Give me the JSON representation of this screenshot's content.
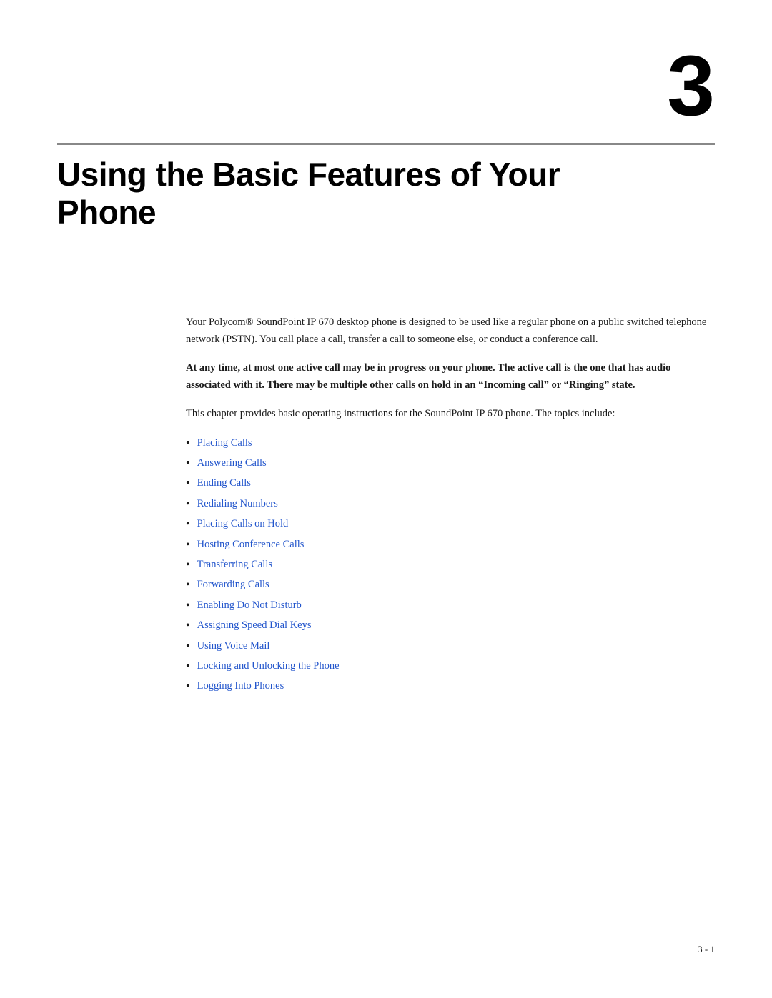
{
  "chapter": {
    "number": "3",
    "title_line1": "Using the Basic Features of Your",
    "title_line2": "Phone"
  },
  "paragraphs": {
    "p1": "Your Polycom® SoundPoint IP 670 desktop phone is designed to be used like a regular phone on a public switched telephone network (PSTN). You call place a call, transfer a call to someone else, or conduct a conference call.",
    "p2": "At any time, at most one active call may be in progress on your phone. The active call is the one that has audio associated with it. There may be multiple other calls on hold in an “Incoming call” or “Ringing” state.",
    "p3": "This chapter provides basic operating instructions for the SoundPoint IP 670 phone. The topics include:"
  },
  "topics": [
    {
      "label": "Placing Calls",
      "href": "#placing-calls"
    },
    {
      "label": "Answering Calls",
      "href": "#answering-calls"
    },
    {
      "label": "Ending Calls",
      "href": "#ending-calls"
    },
    {
      "label": "Redialing Numbers",
      "href": "#redialing-numbers"
    },
    {
      "label": "Placing Calls on Hold",
      "href": "#placing-calls-on-hold"
    },
    {
      "label": "Hosting Conference Calls",
      "href": "#hosting-conference-calls"
    },
    {
      "label": "Transferring Calls",
      "href": "#transferring-calls"
    },
    {
      "label": "Forwarding Calls",
      "href": "#forwarding-calls"
    },
    {
      "label": "Enabling Do Not Disturb",
      "href": "#enabling-do-not-disturb"
    },
    {
      "label": "Assigning Speed Dial Keys",
      "href": "#assigning-speed-dial-keys"
    },
    {
      "label": "Using Voice Mail",
      "href": "#using-voice-mail"
    },
    {
      "label": "Locking and Unlocking the Phone",
      "href": "#locking-unlocking"
    },
    {
      "label": "Logging Into Phones",
      "href": "#logging-into-phones"
    }
  ],
  "page_number": "3 - 1",
  "link_color": "#2255cc"
}
